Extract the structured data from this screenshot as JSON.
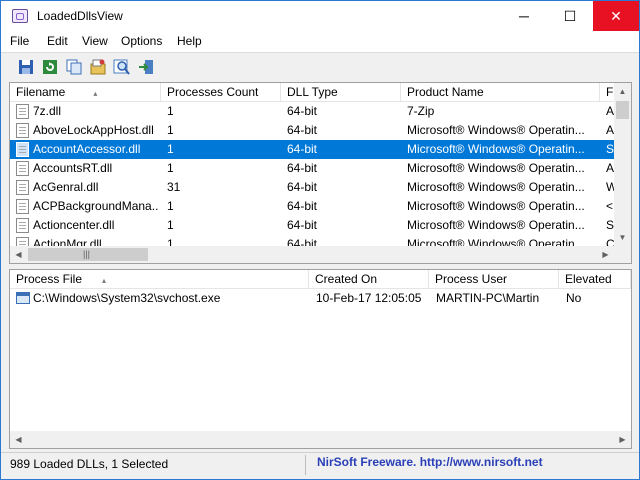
{
  "window": {
    "title": "LoadedDllsView",
    "controls": [
      "─",
      "☐",
      "✕"
    ]
  },
  "menu": [
    "File",
    "Edit",
    "View",
    "Options",
    "Help"
  ],
  "toolbar": [
    "save-icon",
    "refresh-icon",
    "copy-icon",
    "properties-icon",
    "find-icon",
    "exit-icon"
  ],
  "dll_list": {
    "columns": [
      "Filename",
      "Processes Count",
      "DLL Type",
      "Product Name",
      "Fi"
    ],
    "sort_arrow": "▴",
    "rows": [
      {
        "filename": "7z.dll",
        "count": "1",
        "type": "64-bit",
        "product": "7-Zip",
        "extra": "A"
      },
      {
        "filename": "AboveLockAppHost.dll",
        "count": "1",
        "type": "64-bit",
        "product": "Microsoft® Windows® Operatin...",
        "extra": "A"
      },
      {
        "filename": "AccountAccessor.dll",
        "count": "1",
        "type": "64-bit",
        "product": "Microsoft® Windows® Operatin...",
        "extra": "Sy"
      },
      {
        "filename": "AccountsRT.dll",
        "count": "1",
        "type": "64-bit",
        "product": "Microsoft® Windows® Operatin...",
        "extra": "A"
      },
      {
        "filename": "AcGenral.dll",
        "count": "31",
        "type": "64-bit",
        "product": "Microsoft® Windows® Operatin...",
        "extra": "W"
      },
      {
        "filename": "ACPBackgroundMana...",
        "count": "1",
        "type": "64-bit",
        "product": "Microsoft® Windows® Operatin...",
        "extra": "<"
      },
      {
        "filename": "Actioncenter.dll",
        "count": "1",
        "type": "64-bit",
        "product": "Microsoft® Windows® Operatin...",
        "extra": "Se"
      },
      {
        "filename": "ActionMgr.dll",
        "count": "1",
        "type": "64-bit",
        "product": "Microsoft® Windows® Operatin...",
        "extra": "C"
      }
    ],
    "selected_index": 2
  },
  "process_list": {
    "columns": [
      "Process File",
      "Created On",
      "Process User",
      "Elevated"
    ],
    "sort_arrow": "▴",
    "rows": [
      {
        "file": "C:\\Windows\\System32\\svchost.exe",
        "created": "10-Feb-17 12:05:05",
        "user": "MARTIN-PC\\Martin",
        "elevated": "No"
      }
    ]
  },
  "status": {
    "text": "989 Loaded DLLs, 1 Selected",
    "link": "NirSoft Freeware.  http://www.nirsoft.net"
  },
  "colors": {
    "selection": "#0078d7",
    "close_button": "#e81123",
    "link": "#2a3fb8"
  }
}
